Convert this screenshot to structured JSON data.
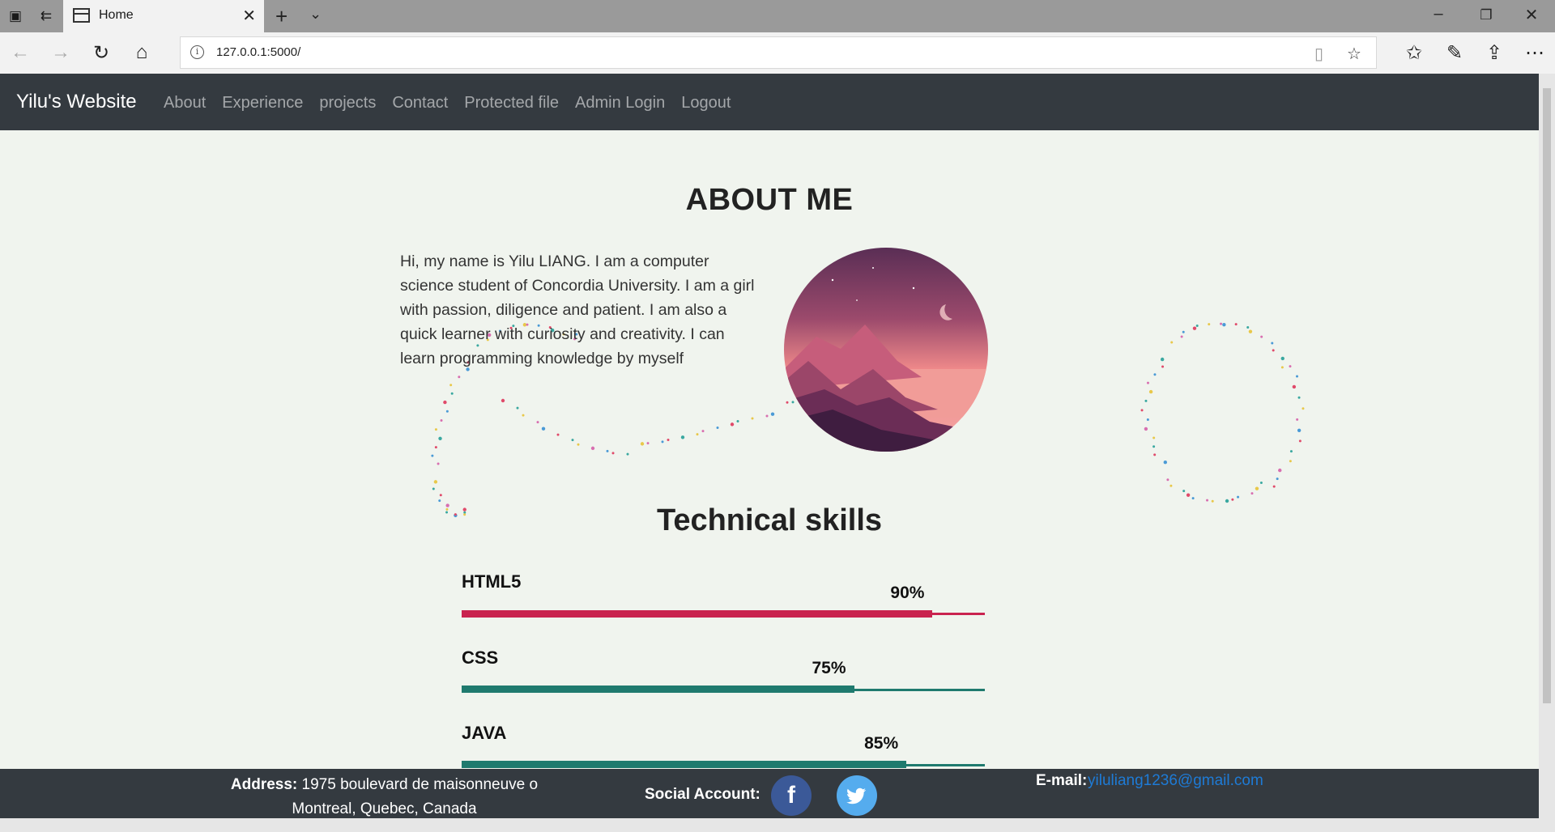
{
  "browser": {
    "tab_title": "Home",
    "url": "127.0.0.1:5000/"
  },
  "site": {
    "brand": "Yilu's Website",
    "nav": [
      "About",
      "Experience",
      "projects",
      "Contact",
      "Protected file",
      "Admin Login",
      "Logout"
    ]
  },
  "about": {
    "title": "ABOUT ME",
    "text": "Hi, my name is Yilu LIANG. I am a computer science student of Concordia University. I am a girl with passion, diligence and patient. I am also a quick learner with curiosity and creativity. I can learn programming knowledge by myself"
  },
  "skills": {
    "title": "Technical skills",
    "items": [
      {
        "name": "HTML5",
        "percent_label": "90%",
        "value": 90,
        "color": "#c9234f"
      },
      {
        "name": "CSS",
        "percent_label": "75%",
        "value": 75,
        "color": "#1f7a6e"
      },
      {
        "name": "JAVA",
        "percent_label": "85%",
        "value": 85,
        "color": "#1f7a6e"
      }
    ]
  },
  "footer": {
    "address_label": "Address:",
    "address_line1": "1975 boulevard de maisonneuve o",
    "address_line2": "Montreal, Quebec, Canada",
    "social_label": "Social Account:",
    "social_icons": [
      "facebook-icon",
      "twitter-icon"
    ],
    "email_label": "E-mail:",
    "email": "yiluliang1236@gmail.com"
  }
}
